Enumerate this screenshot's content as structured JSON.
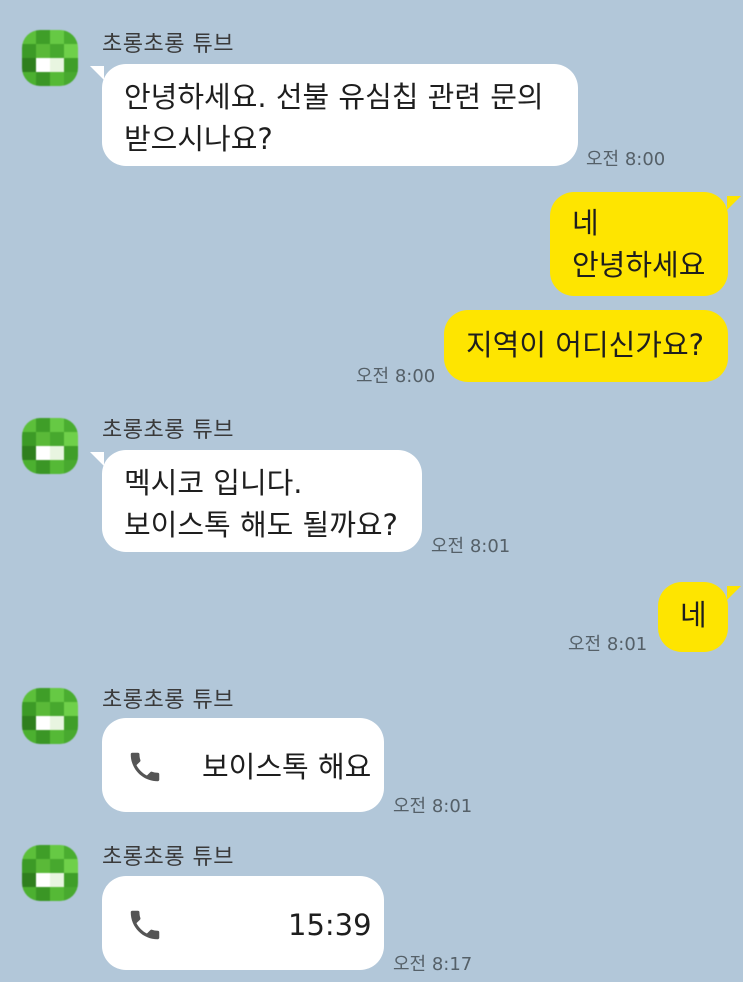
{
  "chat": {
    "sender_name": "초롱초롱 튜브",
    "messages": [
      {
        "from": "other",
        "text": "안녕하세요. 선불 유심칩 관련 문의\n받으시나요?",
        "time": "오전 8:00"
      },
      {
        "from": "me",
        "text": "네\n안녕하세요",
        "time": ""
      },
      {
        "from": "me",
        "text": "지역이 어디신가요?",
        "time": "오전 8:00"
      },
      {
        "from": "other",
        "text": "멕시코 입니다.\n보이스톡 해도 될까요?",
        "time": "오전 8:01"
      },
      {
        "from": "me",
        "text": "네",
        "time": "오전 8:01"
      },
      {
        "from": "other",
        "type": "voice-call",
        "icon": "phone-icon",
        "text": "보이스톡 해요",
        "time": "오전 8:01"
      },
      {
        "from": "other",
        "type": "voice-call",
        "icon": "phone-icon",
        "text": "15:39",
        "time": "오전 8:17"
      }
    ]
  },
  "colors": {
    "background": "#b2c7d9",
    "incoming_bubble": "#ffffff",
    "outgoing_bubble": "#fee500",
    "avatar_green": "#4caf2e"
  }
}
